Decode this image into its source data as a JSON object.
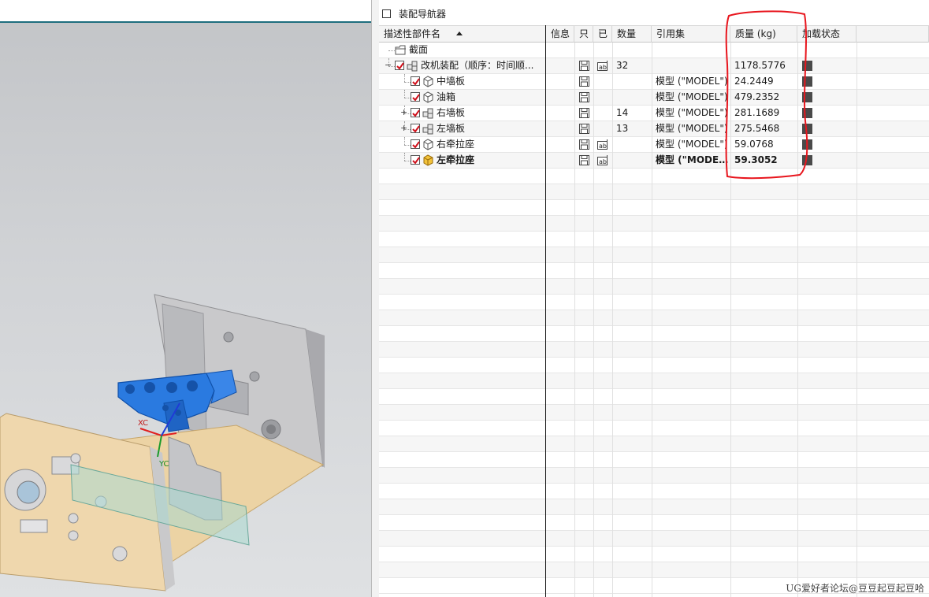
{
  "navigator": {
    "title": "装配导航器",
    "columns": [
      {
        "id": "name",
        "label": "描述性部件名"
      },
      {
        "id": "info",
        "label": "信息"
      },
      {
        "id": "readonly",
        "label": "只"
      },
      {
        "id": "modified",
        "label": "已"
      },
      {
        "id": "quantity",
        "label": "数量"
      },
      {
        "id": "refset",
        "label": "引用集"
      },
      {
        "id": "mass",
        "label": "质量 (kg)"
      },
      {
        "id": "load",
        "label": "加载状态"
      }
    ],
    "sort_column": "name",
    "rows": [
      {
        "name": "截面",
        "icon": "folder-icon",
        "level": 0,
        "checkbox": false,
        "expander": "",
        "readonly": false,
        "modified": false,
        "quantity": "",
        "refset": "",
        "mass": "",
        "loaded": false,
        "bold": false
      },
      {
        "name": "改机装配（顺序：时间顺...",
        "icon": "assembly-icon",
        "level": 0,
        "checkbox": true,
        "expander": "−",
        "readonly": true,
        "modified": true,
        "quantity": "32",
        "refset": "",
        "mass": "1178.5776",
        "loaded": true,
        "bold": false
      },
      {
        "name": "中墙板",
        "icon": "component-icon",
        "level": 1,
        "checkbox": true,
        "expander": "",
        "readonly": true,
        "modified": false,
        "quantity": "",
        "refset": "模型 (\"MODEL\")",
        "mass": "24.2449",
        "loaded": true,
        "bold": false
      },
      {
        "name": "油箱",
        "icon": "component-icon",
        "level": 1,
        "checkbox": true,
        "expander": "",
        "readonly": true,
        "modified": false,
        "quantity": "",
        "refset": "模型 (\"MODEL\")",
        "mass": "479.2352",
        "loaded": true,
        "bold": false
      },
      {
        "name": "右墙板",
        "icon": "assembly-icon",
        "level": 1,
        "checkbox": true,
        "expander": "+",
        "readonly": true,
        "modified": false,
        "quantity": "14",
        "refset": "模型 (\"MODEL\")",
        "mass": "281.1689",
        "loaded": true,
        "bold": false
      },
      {
        "name": "左墙板",
        "icon": "assembly-icon",
        "level": 1,
        "checkbox": true,
        "expander": "+",
        "readonly": true,
        "modified": false,
        "quantity": "13",
        "refset": "模型 (\"MODEL\")",
        "mass": "275.5468",
        "loaded": true,
        "bold": false
      },
      {
        "name": "右牵拉座",
        "icon": "component-icon",
        "level": 1,
        "checkbox": true,
        "expander": "",
        "readonly": true,
        "modified": true,
        "quantity": "",
        "refset": "模型 (\"MODEL\")",
        "mass": "59.0768",
        "loaded": true,
        "bold": false
      },
      {
        "name": "左牵拉座",
        "icon": "work-part-icon",
        "level": 1,
        "checkbox": true,
        "expander": "",
        "readonly": true,
        "modified": true,
        "quantity": "",
        "refset": "模型 (\"MODE...",
        "mass": "59.3052",
        "loaded": true,
        "bold": true
      }
    ],
    "empty_row_count": 27
  },
  "viewport": {
    "axis_labels": {
      "x": "XC",
      "y": "YC"
    }
  },
  "watermark": "UG爱好者论坛@豆豆起豆起豆哈",
  "colors": {
    "annotation": "#e8161e",
    "selected_part": "#1f6fd6",
    "checkbox_mark": "#d0101b",
    "header_bg": "#f4f4f4"
  }
}
